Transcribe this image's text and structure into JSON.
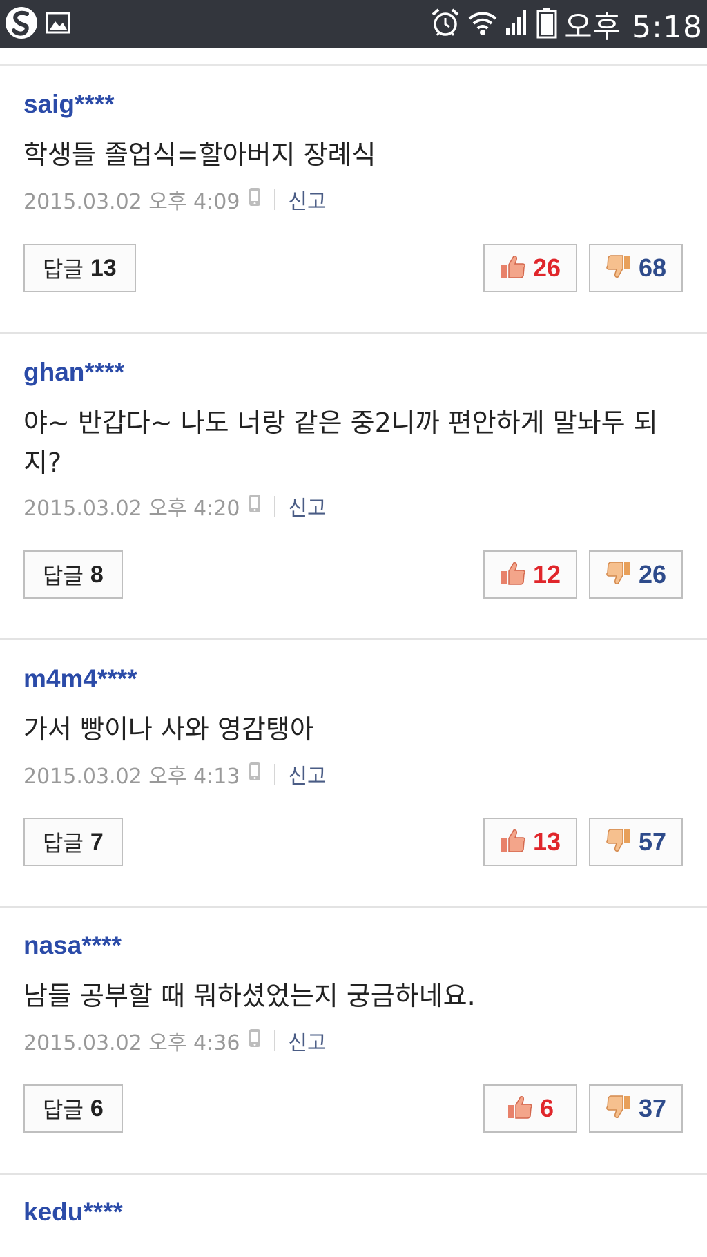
{
  "status_bar": {
    "time": "오후 5:18",
    "icons": [
      "s-app-icon",
      "image-icon",
      "alarm-icon",
      "wifi-icon",
      "signal-icon",
      "battery-icon"
    ]
  },
  "labels": {
    "reply": "답글",
    "report": "신고"
  },
  "colors": {
    "author": "#2b4ba8",
    "like": "#e0262b",
    "dislike": "#2e4b8b",
    "status_bar_bg": "#33363d"
  },
  "comments": [
    {
      "author": "saig****",
      "text": "학생들 졸업식=할아버지 장례식",
      "date": "2015.03.02 오후 4:09",
      "replies": "13",
      "likes": "26",
      "dislikes": "68"
    },
    {
      "author": "ghan****",
      "text": "야~ 반갑다~ 나도 너랑 같은 중2니까 편안하게 말놔두 되지?",
      "date": "2015.03.02 오후 4:20",
      "replies": "8",
      "likes": "12",
      "dislikes": "26"
    },
    {
      "author": "m4m4****",
      "text": "가서 빵이나 사와 영감탱아",
      "date": "2015.03.02 오후 4:13",
      "replies": "7",
      "likes": "13",
      "dislikes": "57"
    },
    {
      "author": "nasa****",
      "text": "남들 공부할 때 뭐하셨었는지 궁금하네요.",
      "date": "2015.03.02 오후 4:36",
      "replies": "6",
      "likes": "6",
      "dislikes": "37"
    },
    {
      "author": "kedu****"
    }
  ]
}
